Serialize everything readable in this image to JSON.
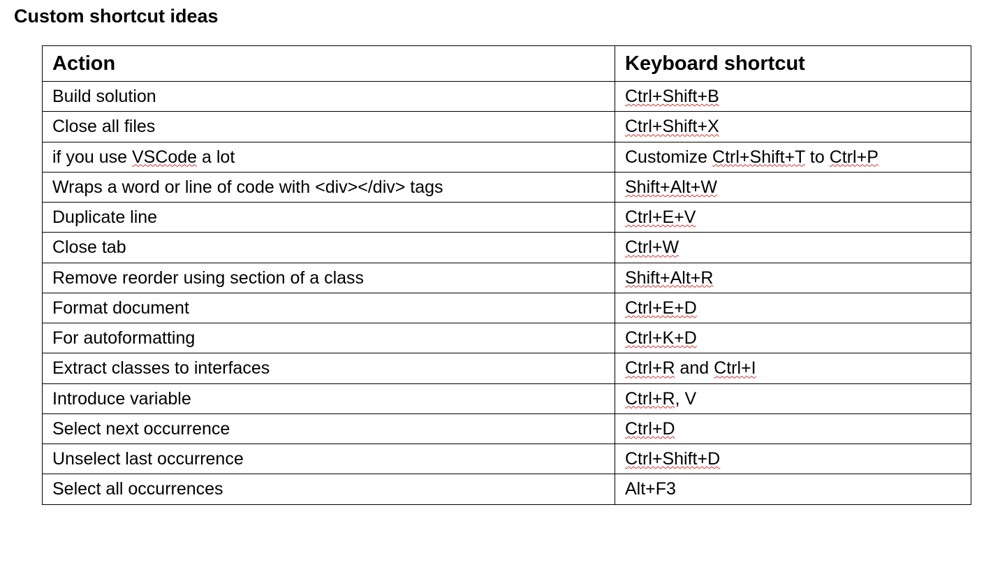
{
  "title": "Custom shortcut ideas",
  "headers": {
    "action": "Action",
    "shortcut": "Keyboard shortcut"
  },
  "rows": [
    {
      "action_segments": [
        {
          "text": "Build solution",
          "squiggle": false
        }
      ],
      "shortcut_segments": [
        {
          "text": "Ctrl+Shift+B",
          "squiggle": true
        }
      ]
    },
    {
      "action_segments": [
        {
          "text": "Close all files",
          "squiggle": false
        }
      ],
      "shortcut_segments": [
        {
          "text": "Ctrl+Shift+X",
          "squiggle": true
        }
      ]
    },
    {
      "action_segments": [
        {
          "text": "if you use ",
          "squiggle": false
        },
        {
          "text": "VSCode",
          "squiggle": true
        },
        {
          "text": " a lot",
          "squiggle": false
        }
      ],
      "shortcut_segments": [
        {
          "text": "Customize ",
          "squiggle": false
        },
        {
          "text": "Ctrl+Shift+T",
          "squiggle": true
        },
        {
          "text": " to ",
          "squiggle": false
        },
        {
          "text": "Ctrl+P",
          "squiggle": true
        }
      ]
    },
    {
      "action_segments": [
        {
          "text": "Wraps a word or line of code with <div></div> tags",
          "squiggle": false
        }
      ],
      "shortcut_segments": [
        {
          "text": "Shift+Alt+W",
          "squiggle": true
        }
      ]
    },
    {
      "action_segments": [
        {
          "text": "Duplicate line",
          "squiggle": false
        }
      ],
      "shortcut_segments": [
        {
          "text": "Ctrl+E+V",
          "squiggle": true
        }
      ]
    },
    {
      "action_segments": [
        {
          "text": "Close tab",
          "squiggle": false
        }
      ],
      "shortcut_segments": [
        {
          "text": "Ctrl+W",
          "squiggle": true
        }
      ]
    },
    {
      "action_segments": [
        {
          "text": "Remove reorder using section of a class",
          "squiggle": false
        }
      ],
      "shortcut_segments": [
        {
          "text": "Shift+Alt+R",
          "squiggle": true
        }
      ]
    },
    {
      "action_segments": [
        {
          "text": "Format document",
          "squiggle": false
        }
      ],
      "shortcut_segments": [
        {
          "text": "Ctrl+E+D",
          "squiggle": true
        }
      ]
    },
    {
      "action_segments": [
        {
          "text": "For autoformatting",
          "squiggle": false
        }
      ],
      "shortcut_segments": [
        {
          "text": "Ctrl+K+D",
          "squiggle": true
        }
      ]
    },
    {
      "action_segments": [
        {
          "text": "Extract classes to interfaces",
          "squiggle": false
        }
      ],
      "shortcut_segments": [
        {
          "text": "Ctrl+R",
          "squiggle": true
        },
        {
          "text": " and ",
          "squiggle": false
        },
        {
          "text": "Ctrl+I",
          "squiggle": true
        }
      ]
    },
    {
      "action_segments": [
        {
          "text": "Introduce variable",
          "squiggle": false
        }
      ],
      "shortcut_segments": [
        {
          "text": "Ctrl+R",
          "squiggle": true
        },
        {
          "text": ", V",
          "squiggle": false
        }
      ]
    },
    {
      "action_segments": [
        {
          "text": "Select next occurrence",
          "squiggle": false
        }
      ],
      "shortcut_segments": [
        {
          "text": "Ctrl+D",
          "squiggle": true
        }
      ]
    },
    {
      "action_segments": [
        {
          "text": "Unselect last occurrence",
          "squiggle": false
        }
      ],
      "shortcut_segments": [
        {
          "text": "Ctrl+Shift+D",
          "squiggle": true
        }
      ]
    },
    {
      "action_segments": [
        {
          "text": "Select all occurrences",
          "squiggle": false
        }
      ],
      "shortcut_segments": [
        {
          "text": "Alt+F3",
          "squiggle": false
        }
      ]
    }
  ]
}
